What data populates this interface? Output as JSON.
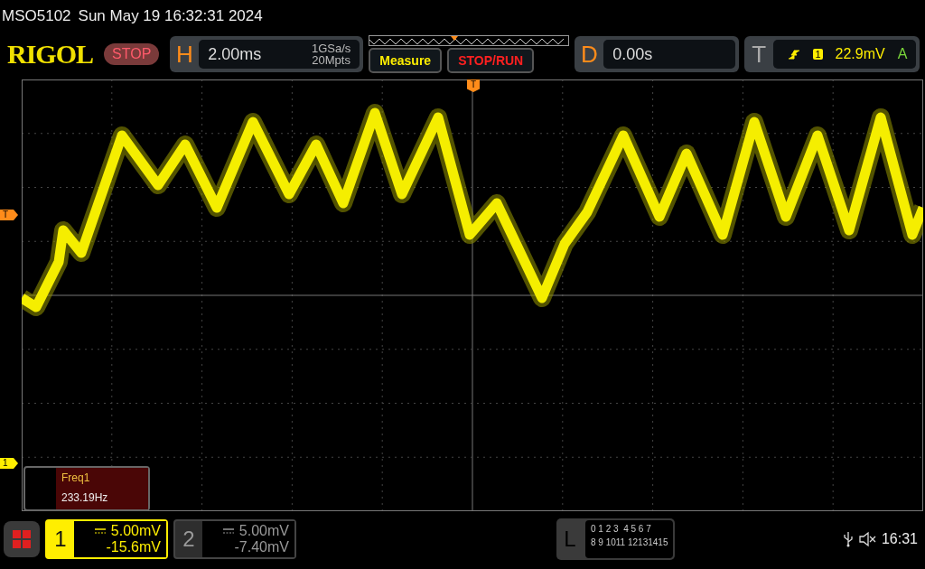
{
  "title_bar": {
    "model": "MSO5102",
    "datetime": "Sun May 19 16:32:31 2024"
  },
  "top_bar": {
    "logo": "RIGOL",
    "run_state": "STOP",
    "horizontal": {
      "label": "H",
      "timebase": "2.00ms",
      "sample_rate": "1GSa/s",
      "memory_depth": "20Mpts"
    },
    "measure_button": "Measure",
    "stop_run_button": "STOP/RUN",
    "delay": {
      "label": "D",
      "value": "0.00s"
    },
    "trigger": {
      "label": "T",
      "source": "1",
      "level": "22.9mV",
      "mode": "A"
    }
  },
  "markers": {
    "trigger_level": "T",
    "trigger_position": "T",
    "channel": "1"
  },
  "measurement": {
    "name": "Freq1",
    "value": "233.19Hz"
  },
  "channels": [
    {
      "number": "1",
      "scale": "5.00mV",
      "offset": "-15.6mV",
      "selected": true
    },
    {
      "number": "2",
      "scale": "5.00mV",
      "offset": "-7.40mV",
      "selected": false
    }
  ],
  "logic": {
    "label": "L",
    "rows": [
      "0 1 2 3  4 5 6 7",
      "8 9 1011 12131415"
    ]
  },
  "status": {
    "time": "16:31"
  }
}
